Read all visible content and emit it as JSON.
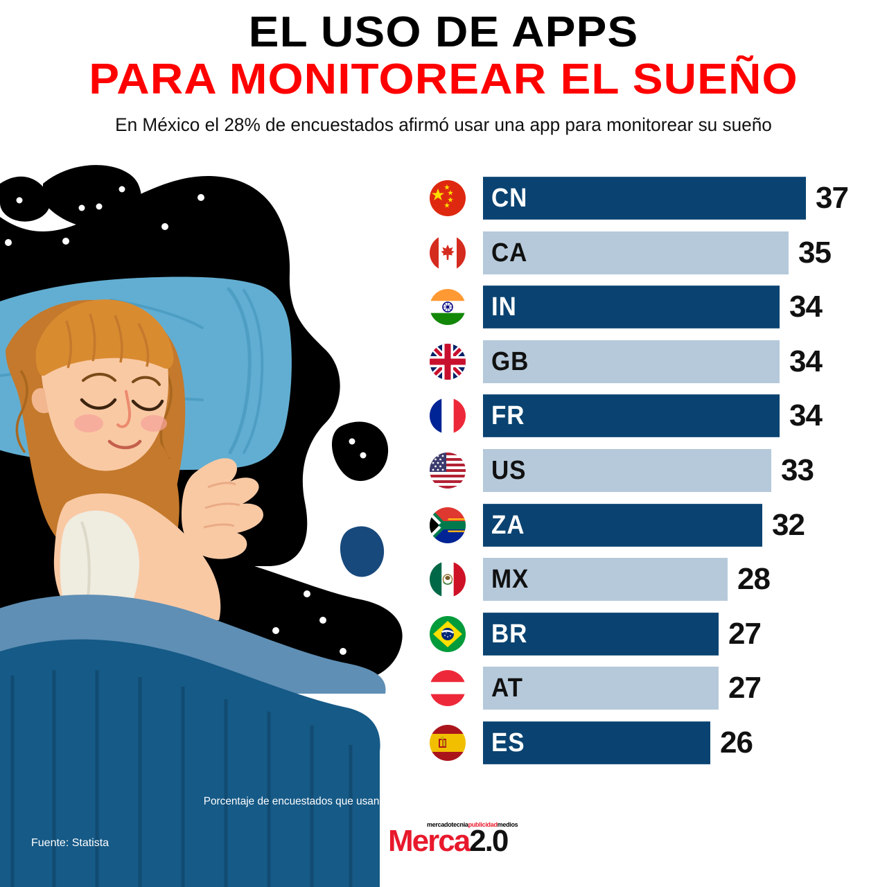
{
  "header": {
    "title_line1": "EL USO DE APPS",
    "title_line2": "PARA MONITOREAR EL SUEÑO",
    "subtitle": "En México el 28% de encuestados afirmó usar una app para monitorear su sueño"
  },
  "footer": {
    "note": "Porcentaje de encuestados que usan aplicaciones de monitoreo del sueño en los últimos doce meses",
    "source": "Fuente: Statista",
    "logo_tagline_1": "mercadotecnia",
    "logo_tagline_2": "publicidad",
    "logo_tagline_3": "medios",
    "logo_main_red": "Merca",
    "logo_main_black": "2.0"
  },
  "colors": {
    "bar_dark": "#0a4371",
    "bar_light": "#b5c9da",
    "title_red": "#ff0000",
    "title_black": "#000000",
    "logo_red": "#e8192c",
    "night_sky": "#000000",
    "pillow": "#67b3d4",
    "blanket": "#165a87"
  },
  "chart_data": {
    "type": "bar",
    "title": "EL USO DE APPS PARA MONITOREAR EL SUEÑO",
    "subtitle": "En México el 28% de encuestados afirmó usar una app para monitorear su sueño",
    "xlabel": "Porcentaje de encuestados que usan aplicaciones de monitoreo del sueño en los últimos doce meses",
    "ylabel": "",
    "orientation": "horizontal",
    "grid": false,
    "legend": "none",
    "xlim": [
      0,
      40
    ],
    "unit": "%",
    "source": "Statista",
    "categories": [
      "CN",
      "CA",
      "IN",
      "GB",
      "FR",
      "US",
      "ZA",
      "MX",
      "BR",
      "AT",
      "ES"
    ],
    "values": [
      37,
      35,
      34,
      34,
      34,
      33,
      32,
      28,
      27,
      27,
      26
    ],
    "rows": [
      {
        "code": "CN",
        "value": 37,
        "flag": "cn-flag-icon",
        "style": "dark"
      },
      {
        "code": "CA",
        "value": 35,
        "flag": "ca-flag-icon",
        "style": "light"
      },
      {
        "code": "IN",
        "value": 34,
        "flag": "in-flag-icon",
        "style": "dark"
      },
      {
        "code": "GB",
        "value": 34,
        "flag": "gb-flag-icon",
        "style": "light"
      },
      {
        "code": "FR",
        "value": 34,
        "flag": "fr-flag-icon",
        "style": "dark"
      },
      {
        "code": "US",
        "value": 33,
        "flag": "us-flag-icon",
        "style": "light"
      },
      {
        "code": "ZA",
        "value": 32,
        "flag": "za-flag-icon",
        "style": "dark"
      },
      {
        "code": "MX",
        "value": 28,
        "flag": "mx-flag-icon",
        "style": "light"
      },
      {
        "code": "BR",
        "value": 27,
        "flag": "br-flag-icon",
        "style": "dark"
      },
      {
        "code": "AT",
        "value": 27,
        "flag": "at-flag-icon",
        "style": "light"
      },
      {
        "code": "ES",
        "value": 26,
        "flag": "es-flag-icon",
        "style": "dark"
      }
    ]
  }
}
